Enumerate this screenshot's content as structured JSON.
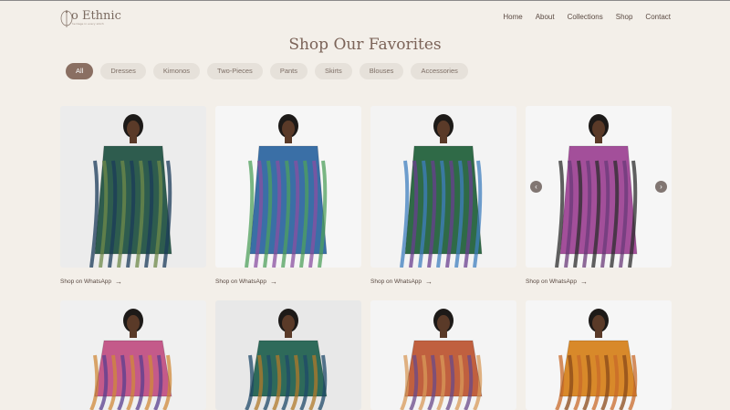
{
  "brand": {
    "name": "o Ethnic",
    "tagline": "heritage in every stitch"
  },
  "nav": [
    "Home",
    "About",
    "Collections",
    "Shop",
    "Contact"
  ],
  "page": {
    "title": "Shop Our Favorites"
  },
  "filters": [
    {
      "label": "All",
      "active": true
    },
    {
      "label": "Dresses",
      "active": false
    },
    {
      "label": "Kimonos",
      "active": false
    },
    {
      "label": "Two-Pieces",
      "active": false
    },
    {
      "label": "Pants",
      "active": false
    },
    {
      "label": "Skirts",
      "active": false
    },
    {
      "label": "Blouses",
      "active": false
    },
    {
      "label": "Accessories",
      "active": false
    }
  ],
  "products": [
    {
      "cta": "Shop on WhatsApp",
      "bg": "#ececec",
      "palette": [
        "#2e5c4e",
        "#6f8a4a",
        "#1b3b5a"
      ]
    },
    {
      "cta": "Shop on WhatsApp",
      "bg": "#f6f6f6",
      "palette": [
        "#3a6fa6",
        "#8a4fa0",
        "#4fa05c"
      ]
    },
    {
      "cta": "Shop on WhatsApp",
      "bg": "#f3f3f3",
      "palette": [
        "#2f6a47",
        "#6a3f8f",
        "#3f7fbf"
      ]
    },
    {
      "cta": "Shop on WhatsApp",
      "bg": "#f6f6f6",
      "palette": [
        "#a34f9a",
        "#6a3a78",
        "#2c2c2c"
      ],
      "carousel": true
    },
    {
      "cta": "",
      "bg": "#f0f0f0",
      "palette": [
        "#c45a8a",
        "#5a3f8f",
        "#d08a3a"
      ]
    },
    {
      "cta": "",
      "bg": "#e8e8e8",
      "palette": [
        "#2e6a5a",
        "#b07a2a",
        "#1f4a6a"
      ]
    },
    {
      "cta": "",
      "bg": "#f4f4f4",
      "palette": [
        "#c0603f",
        "#6a4a8a",
        "#d89a5a"
      ]
    },
    {
      "cta": "",
      "bg": "#f6f6f6",
      "palette": [
        "#d8892a",
        "#8a4a1a",
        "#c86a2a"
      ]
    }
  ],
  "carousel": {
    "prev_icon": "chevron-left-icon",
    "next_icon": "chevron-right-icon",
    "prev": "‹",
    "next": "›"
  },
  "colors": {
    "background": "#f3efe9",
    "accent": "#8a6f62",
    "chip": "#e6e1da"
  }
}
